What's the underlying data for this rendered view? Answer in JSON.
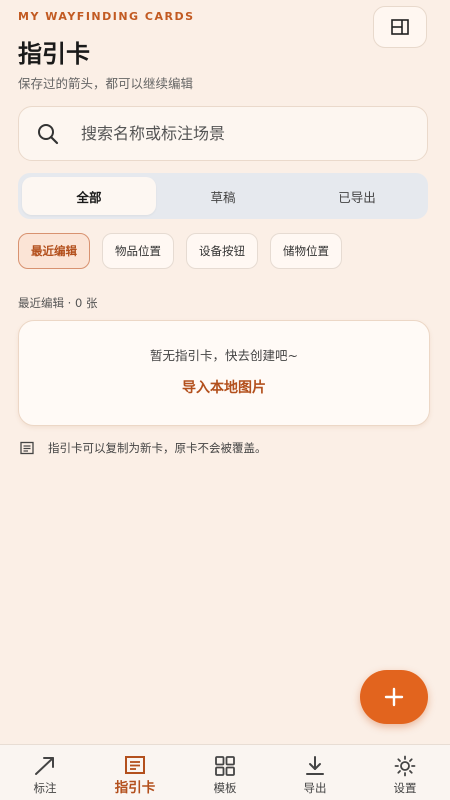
{
  "header": {
    "eyebrow": "MY WAYFINDING CARDS",
    "title": "指引卡",
    "subtitle": "保存过的箭头，都可以继续编辑",
    "corner_button_icon": "layout-grid-icon"
  },
  "search": {
    "placeholder": "搜索名称或标注场景",
    "value": ""
  },
  "tabs": [
    {
      "label": "全部",
      "active": true
    },
    {
      "label": "草稿",
      "active": false
    },
    {
      "label": "已导出",
      "active": false
    }
  ],
  "chips": [
    {
      "label": "最近编辑",
      "active": true
    },
    {
      "label": "物品位置",
      "active": false
    },
    {
      "label": "设备按钮",
      "active": false
    },
    {
      "label": "储物位置",
      "active": false
    }
  ],
  "list": {
    "count_label": "最近编辑 · 0 张"
  },
  "empty_state": {
    "message": "暂无指引卡，快去创建吧~",
    "action_label": "导入本地图片"
  },
  "tip": {
    "text": "指引卡可以复制为新卡，原卡不会被覆盖。"
  },
  "fab": {
    "icon": "plus-icon"
  },
  "bottom_nav": [
    {
      "label": "标注",
      "icon": "arrow-icon",
      "active": false
    },
    {
      "label": "指引卡",
      "icon": "card-icon",
      "active": true
    },
    {
      "label": "模板",
      "icon": "grid-icon",
      "active": false
    },
    {
      "label": "导出",
      "icon": "download-icon",
      "active": false
    },
    {
      "label": "设置",
      "icon": "sun-gear-icon",
      "active": false
    }
  ],
  "colors": {
    "accent": "#e2641e",
    "accent_text": "#b3501d",
    "background": "#fbefe6"
  }
}
